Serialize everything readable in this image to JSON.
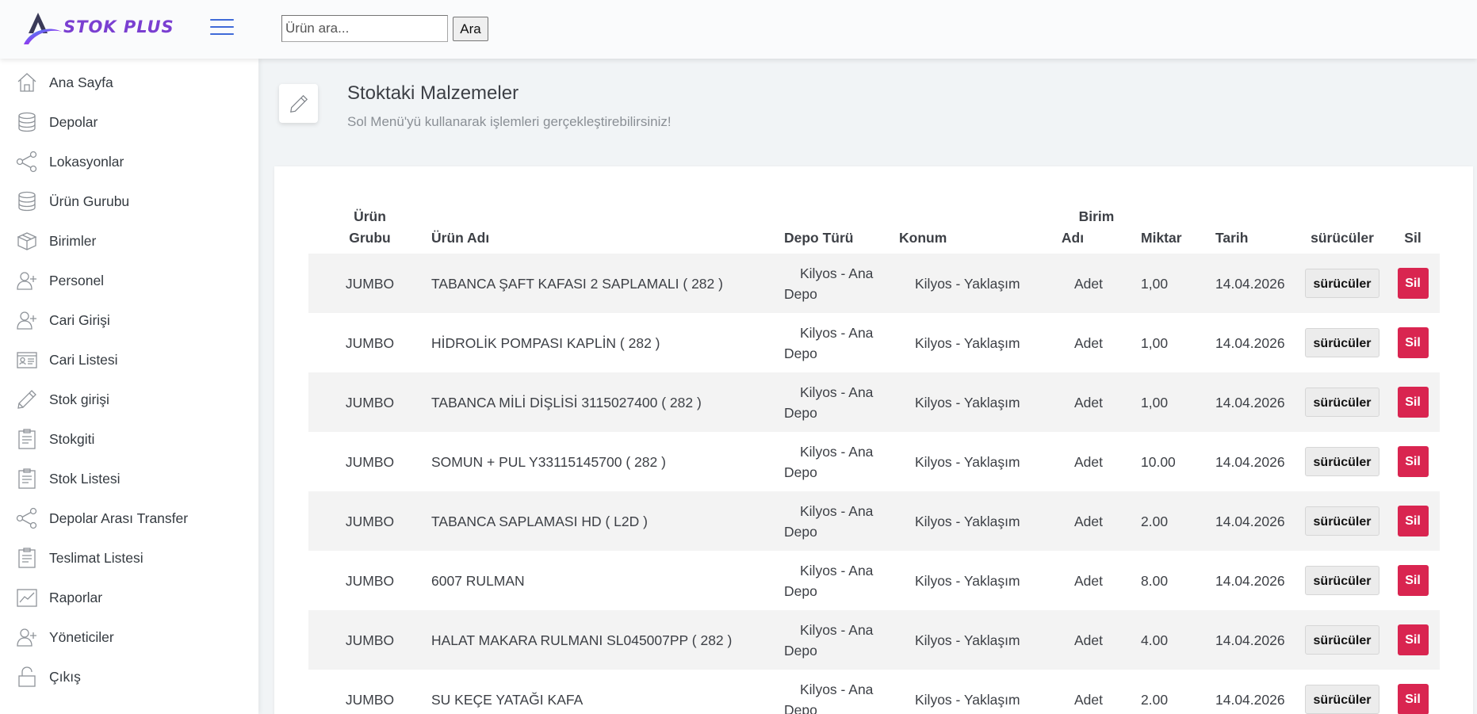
{
  "header": {
    "logo_text": "STOK PLUS",
    "search_placeholder": "Ürün ara...",
    "search_button": "Ara"
  },
  "sidebar": {
    "items": [
      {
        "label": "Ana Sayfa",
        "icon": "home-icon"
      },
      {
        "label": "Depolar",
        "icon": "database-icon"
      },
      {
        "label": "Lokasyonlar",
        "icon": "share-icon"
      },
      {
        "label": "Ürün Gurubu",
        "icon": "database-icon"
      },
      {
        "label": "Birimler",
        "icon": "box-icon"
      },
      {
        "label": "Personel",
        "icon": "add-user-icon"
      },
      {
        "label": "Cari Girişi",
        "icon": "add-user-icon"
      },
      {
        "label": "Cari Listesi",
        "icon": "id-card-icon"
      },
      {
        "label": "Stok girişi",
        "icon": "pencil-icon"
      },
      {
        "label": "Stokgiti",
        "icon": "clipboard-icon"
      },
      {
        "label": "Stok Listesi",
        "icon": "clipboard-icon"
      },
      {
        "label": "Depolar Arası Transfer",
        "icon": "share-icon"
      },
      {
        "label": "Teslimat Listesi",
        "icon": "clipboard-icon"
      },
      {
        "label": "Raporlar",
        "icon": "chart-icon"
      },
      {
        "label": "Yöneticiler",
        "icon": "add-user-icon"
      },
      {
        "label": "Çıkış",
        "icon": "unlock-icon"
      }
    ]
  },
  "page": {
    "title": "Stoktaki Malzemeler",
    "subtitle": "Sol Menü'yü kullanarak işlemleri gerçekleştirebilirsiniz!"
  },
  "table": {
    "headers": {
      "group_line1": "Ürün",
      "group_line2": "Grubu",
      "name": "Ürün Adı",
      "depot_type": "Depo Türü",
      "location": "Konum",
      "unit_line1": "Birim",
      "unit_line2": "Adı",
      "quantity": "Miktar",
      "date": "Tarih",
      "drivers": "sürücüler",
      "delete": "Sil"
    },
    "rows": [
      {
        "group": "JUMBO",
        "name": "TABANCA ŞAFT KAFASI 2 SAPLAMALI ( 282 )",
        "depot": "Kilyos - Ana Depo",
        "location": "Kilyos - Yaklaşım",
        "unit": "Adet",
        "quantity": "1,00",
        "date": "14.04.2026",
        "drivers_btn": "sürücüler",
        "delete_btn": "Sil"
      },
      {
        "group": "JUMBO",
        "name": "HİDROLİK POMPASI KAPLİN ( 282 )",
        "depot": "Kilyos - Ana Depo",
        "location": "Kilyos - Yaklaşım",
        "unit": "Adet",
        "quantity": "1,00",
        "date": "14.04.2026",
        "drivers_btn": "sürücüler",
        "delete_btn": "Sil"
      },
      {
        "group": "JUMBO",
        "name": "TABANCA MİLİ DİŞLİSİ 3115027400 ( 282 )",
        "depot": "Kilyos - Ana Depo",
        "location": "Kilyos - Yaklaşım",
        "unit": "Adet",
        "quantity": "1,00",
        "date": "14.04.2026",
        "drivers_btn": "sürücüler",
        "delete_btn": "Sil"
      },
      {
        "group": "JUMBO",
        "name": "SOMUN + PUL Y33115145700 ( 282 )",
        "depot": "Kilyos - Ana Depo",
        "location": "Kilyos - Yaklaşım",
        "unit": "Adet",
        "quantity": "10.00",
        "date": "14.04.2026",
        "drivers_btn": "sürücüler",
        "delete_btn": "Sil"
      },
      {
        "group": "JUMBO",
        "name": "TABANCA SAPLAMASI HD ( L2D )",
        "depot": "Kilyos - Ana Depo",
        "location": "Kilyos - Yaklaşım",
        "unit": "Adet",
        "quantity": "2.00",
        "date": "14.04.2026",
        "drivers_btn": "sürücüler",
        "delete_btn": "Sil"
      },
      {
        "group": "JUMBO",
        "name": "6007 RULMAN",
        "depot": "Kilyos - Ana Depo",
        "location": "Kilyos - Yaklaşım",
        "unit": "Adet",
        "quantity": "8.00",
        "date": "14.04.2026",
        "drivers_btn": "sürücüler",
        "delete_btn": "Sil"
      },
      {
        "group": "JUMBO",
        "name": "HALAT MAKARA RULMANI SL045007PP ( 282 )",
        "depot": "Kilyos - Ana Depo",
        "location": "Kilyos - Yaklaşım",
        "unit": "Adet",
        "quantity": "4.00",
        "date": "14.04.2026",
        "drivers_btn": "sürücüler",
        "delete_btn": "Sil"
      },
      {
        "group": "JUMBO",
        "name": "SU KEÇE YATAĞI KAFA",
        "depot": "Kilyos - Ana Depo",
        "location": "Kilyos - Yaklaşım",
        "unit": "Adet",
        "quantity": "2.00",
        "date": "14.04.2026",
        "drivers_btn": "sürücüler",
        "delete_btn": "Sil"
      }
    ]
  },
  "colors": {
    "accent": "#3f6ad8",
    "danger": "#d92550",
    "logo": "#7a3fd1"
  }
}
